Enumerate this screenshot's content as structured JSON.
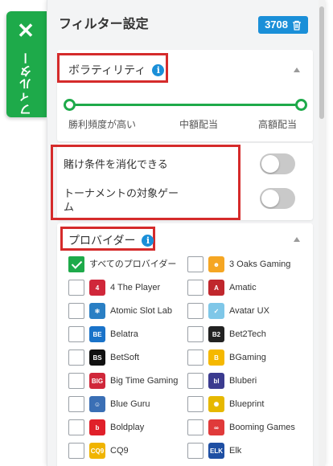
{
  "tab": {
    "close_glyph": "✕",
    "label": "フィルター"
  },
  "header": {
    "title": "フィルター設定",
    "count": "3708",
    "trash_icon": "trash-icon"
  },
  "volatility": {
    "title": "ボラティリティ",
    "info_glyph": "i",
    "labels": [
      "勝利頻度が高い",
      "中額配当",
      "高額配当"
    ]
  },
  "toggles": [
    {
      "label": "賭け条件を消化できる",
      "on": false
    },
    {
      "label": "トーナメントの対象ゲーム",
      "on": false
    }
  ],
  "providers": {
    "title": "プロバイダー",
    "info_glyph": "i",
    "items": [
      {
        "name": "すべてのプロバイダー",
        "checked": true,
        "logo": "",
        "logo_color": ""
      },
      {
        "name": "3 Oaks Gaming",
        "checked": false,
        "logo": "☻",
        "logo_color": "#f5a623"
      },
      {
        "name": "4 The Player",
        "checked": false,
        "logo": "4",
        "logo_color": "#d0273a"
      },
      {
        "name": "Amatic",
        "checked": false,
        "logo": "A",
        "logo_color": "#c0272d"
      },
      {
        "name": "Atomic Slot Lab",
        "checked": false,
        "logo": "⚛",
        "logo_color": "#2a7fc4"
      },
      {
        "name": "Avatar UX",
        "checked": false,
        "logo": "✓",
        "logo_color": "#7fc7e8"
      },
      {
        "name": "Belatra",
        "checked": false,
        "logo": "BE",
        "logo_color": "#1a73c9"
      },
      {
        "name": "Bet2Tech",
        "checked": false,
        "logo": "B2",
        "logo_color": "#222222"
      },
      {
        "name": "BetSoft",
        "checked": false,
        "logo": "BS",
        "logo_color": "#111111"
      },
      {
        "name": "BGaming",
        "checked": false,
        "logo": "B",
        "logo_color": "#f5b800"
      },
      {
        "name": "Big Time Gaming",
        "checked": false,
        "logo": "BIG",
        "logo_color": "#d0273a"
      },
      {
        "name": "Bluberi",
        "checked": false,
        "logo": "bl",
        "logo_color": "#3b3b8f"
      },
      {
        "name": "Blue Guru",
        "checked": false,
        "logo": "☺",
        "logo_color": "#3a6fb5"
      },
      {
        "name": "Blueprint",
        "checked": false,
        "logo": "✺",
        "logo_color": "#e6b800"
      },
      {
        "name": "Boldplay",
        "checked": false,
        "logo": "b",
        "logo_color": "#e0202a"
      },
      {
        "name": "Booming Games",
        "checked": false,
        "logo": "∞",
        "logo_color": "#e03a3a"
      },
      {
        "name": "CQ9",
        "checked": false,
        "logo": "CQ9",
        "logo_color": "#f0b400"
      },
      {
        "name": "Elk",
        "checked": false,
        "logo": "ELK",
        "logo_color": "#1f4fa3"
      }
    ]
  }
}
